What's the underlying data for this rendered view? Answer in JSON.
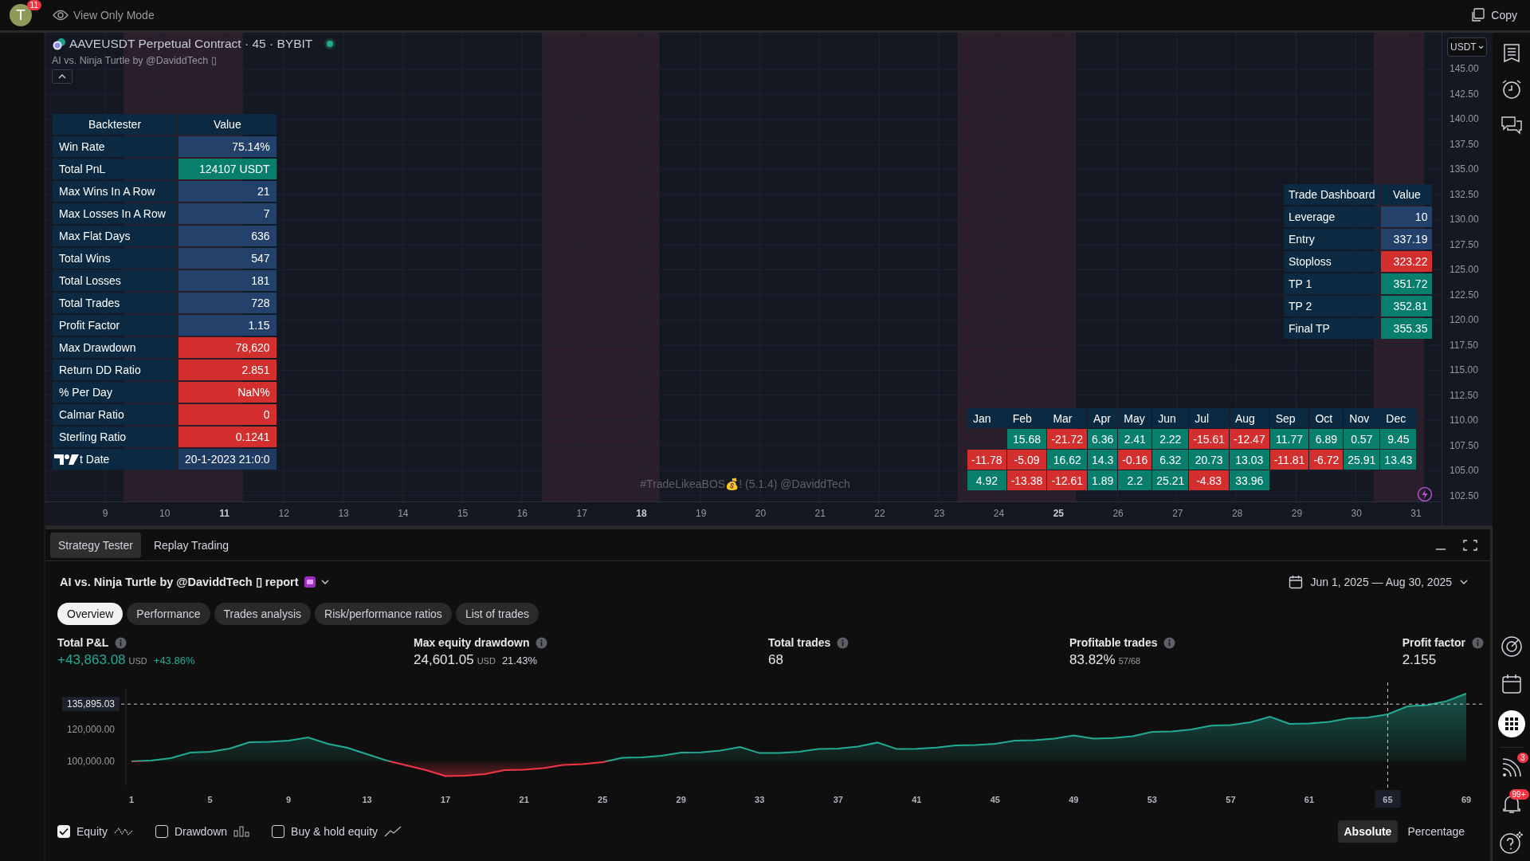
{
  "topbar": {
    "avatar_letter": "T",
    "avatar_badge": "11",
    "mode": "View Only Mode",
    "copy": "Copy"
  },
  "chart": {
    "symbol": "AAVEUSDT Perpetual Contract · 45 · BYBIT",
    "market_open": true,
    "indicator": "AI vs. Ninja Turtle by @DaviddTech ▯",
    "currency": "USDT",
    "watermark": "#TradeLikeaBOS💰! (5.1.4) @DaviddTech",
    "price_axis": [
      "145.00",
      "142.50",
      "140.00",
      "137.50",
      "135.00",
      "132.50",
      "130.00",
      "127.50",
      "125.00",
      "122.50",
      "120.00",
      "117.50",
      "115.00",
      "112.50",
      "110.00",
      "107.50",
      "105.00",
      "102.50"
    ],
    "time_axis": [
      {
        "label": "9",
        "emphasized": false
      },
      {
        "label": "10",
        "emphasized": false
      },
      {
        "label": "11",
        "emphasized": true
      },
      {
        "label": "12",
        "emphasized": false
      },
      {
        "label": "13",
        "emphasized": false
      },
      {
        "label": "14",
        "emphasized": false
      },
      {
        "label": "15",
        "emphasized": false
      },
      {
        "label": "16",
        "emphasized": false
      },
      {
        "label": "17",
        "emphasized": false
      },
      {
        "label": "18",
        "emphasized": true
      },
      {
        "label": "19",
        "emphasized": false
      },
      {
        "label": "20",
        "emphasized": false
      },
      {
        "label": "21",
        "emphasized": false
      },
      {
        "label": "22",
        "emphasized": false
      },
      {
        "label": "23",
        "emphasized": false
      },
      {
        "label": "24",
        "emphasized": false
      },
      {
        "label": "25",
        "emphasized": true
      },
      {
        "label": "26",
        "emphasized": false
      },
      {
        "label": "27",
        "emphasized": false
      },
      {
        "label": "28",
        "emphasized": false
      },
      {
        "label": "29",
        "emphasized": false
      },
      {
        "label": "30",
        "emphasized": false
      },
      {
        "label": "31",
        "emphasized": false
      }
    ],
    "backtester": {
      "columns": [
        "Backtester",
        "Value"
      ],
      "rows": [
        {
          "label": "Win Rate",
          "value": "75.14%",
          "color": "#24416b"
        },
        {
          "label": "Total PnL",
          "value": "124107 USDT",
          "color": "#087f6d"
        },
        {
          "label": "Max Wins In A Row",
          "value": "21",
          "color": "#24416b"
        },
        {
          "label": "Max Losses In A Row",
          "value": "7",
          "color": "#24416b"
        },
        {
          "label": "Max Flat Days",
          "value": "636",
          "color": "#24416b"
        },
        {
          "label": "Total Wins",
          "value": "547",
          "color": "#24416b"
        },
        {
          "label": "Total Losses",
          "value": "181",
          "color": "#24416b"
        },
        {
          "label": "Total Trades",
          "value": "728",
          "color": "#24416b"
        },
        {
          "label": "Profit Factor",
          "value": "1.15",
          "color": "#24416b"
        },
        {
          "label": "Max Drawdown",
          "value": "78,620",
          "color": "#d32f2f"
        },
        {
          "label": "Return DD Ratio",
          "value": "2.851",
          "color": "#d32f2f"
        },
        {
          "label": "% Per Day",
          "value": "NaN%",
          "color": "#d32f2f"
        },
        {
          "label": "Calmar Ratio",
          "value": "0",
          "color": "#d32f2f"
        },
        {
          "label": "Sterling Ratio",
          "value": "0.1241",
          "color": "#d32f2f"
        },
        {
          "label": "t Date",
          "value": "20-1-2023 21:0:0",
          "color": "#1f3b62",
          "covered_by_logo": true
        }
      ]
    },
    "trade_dashboard": {
      "columns": [
        "Trade Dashboard",
        "Value"
      ],
      "rows": [
        {
          "label": "Leverage",
          "value": "10",
          "color": "#24416b"
        },
        {
          "label": "Entry",
          "value": "337.19",
          "color": "#24416b"
        },
        {
          "label": "Stoploss",
          "value": "323.22",
          "color": "#d32f2f"
        },
        {
          "label": "TP 1",
          "value": "351.72",
          "color": "#087f6d"
        },
        {
          "label": "TP 2",
          "value": "352.81",
          "color": "#087f6d"
        },
        {
          "label": "Final TP",
          "value": "355.35",
          "color": "#087f6d"
        }
      ]
    },
    "monthly_returns": {
      "months": [
        "Jan",
        "Feb",
        "Mar",
        "Apr",
        "May",
        "Jun",
        "Jul",
        "Aug",
        "Sep",
        "Oct",
        "Nov",
        "Dec"
      ],
      "rows": [
        [
          null,
          {
            "value": "15.68",
            "color": "#087f6d"
          },
          {
            "value": "-21.72",
            "color": "#d32f2f"
          },
          {
            "value": "6.36",
            "color": "#087f6d"
          },
          {
            "value": "2.41",
            "color": "#087f6d"
          },
          {
            "value": "2.22",
            "color": "#087f6d"
          },
          {
            "value": "-15.61",
            "color": "#d32f2f"
          },
          {
            "value": "-12.47",
            "color": "#d32f2f"
          },
          {
            "value": "11.77",
            "color": "#087f6d"
          },
          {
            "value": "6.89",
            "color": "#087f6d"
          },
          {
            "value": "0.57",
            "color": "#087f6d"
          },
          {
            "value": "9.45",
            "color": "#087f6d"
          }
        ],
        [
          {
            "value": "-11.78",
            "color": "#d32f2f"
          },
          {
            "value": "-5.09",
            "color": "#d32f2f"
          },
          {
            "value": "16.62",
            "color": "#087f6d"
          },
          {
            "value": "14.3",
            "color": "#087f6d"
          },
          {
            "value": "-0.16",
            "color": "#d32f2f"
          },
          {
            "value": "6.32",
            "color": "#087f6d"
          },
          {
            "value": "20.73",
            "color": "#087f6d"
          },
          {
            "value": "13.03",
            "color": "#087f6d"
          },
          {
            "value": "-11.81",
            "color": "#d32f2f"
          },
          {
            "value": "-6.72",
            "color": "#d32f2f"
          },
          {
            "value": "25.91",
            "color": "#087f6d"
          },
          {
            "value": "13.43",
            "color": "#087f6d"
          }
        ],
        [
          {
            "value": "4.92",
            "color": "#087f6d"
          },
          {
            "value": "-13.38",
            "color": "#d32f2f"
          },
          {
            "value": "-12.61",
            "color": "#d32f2f"
          },
          {
            "value": "1.89",
            "color": "#087f6d"
          },
          {
            "value": "2.2",
            "color": "#087f6d"
          },
          {
            "value": "25.21",
            "color": "#087f6d"
          },
          {
            "value": "-4.83",
            "color": "#d32f2f"
          },
          {
            "value": "33.96",
            "color": "#087f6d"
          },
          null,
          null,
          null,
          null
        ]
      ]
    }
  },
  "strategy_panel": {
    "tabs": [
      {
        "label": "Strategy Tester",
        "selected": true
      },
      {
        "label": "Replay Trading",
        "selected": false
      }
    ],
    "report_title": "AI vs. Ninja Turtle by @DaviddTech ▯ report",
    "date_range": "Jun 1, 2025 — Aug 30, 2025",
    "sections": [
      {
        "label": "Overview",
        "selected": true
      },
      {
        "label": "Performance",
        "selected": false
      },
      {
        "label": "Trades analysis",
        "selected": false
      },
      {
        "label": "Risk/performance ratios",
        "selected": false
      },
      {
        "label": "List of trades",
        "selected": false
      }
    ],
    "metrics": [
      {
        "label": "Total P&L",
        "value": "+43,863.08",
        "unit": "USD",
        "extra": "+43.86%",
        "positive": true
      },
      {
        "label": "Max equity drawdown",
        "value": "24,601.05",
        "unit": "USD",
        "extra": "21.43%",
        "positive": false
      },
      {
        "label": "Total trades",
        "value": "68",
        "positive": false
      },
      {
        "label": "Profitable trades",
        "value": "83.82%",
        "extra": "57/68",
        "positive": false
      },
      {
        "label": "Profit factor",
        "value": "2.155",
        "positive": false
      }
    ],
    "chart_data": {
      "type": "area",
      "x": [
        1,
        2,
        3,
        4,
        5,
        6,
        7,
        8,
        9,
        10,
        11,
        12,
        13,
        14,
        15,
        16,
        17,
        18,
        19,
        20,
        21,
        22,
        23,
        24,
        25,
        26,
        27,
        28,
        29,
        30,
        31,
        32,
        33,
        34,
        35,
        36,
        37,
        38,
        39,
        40,
        41,
        42,
        43,
        44,
        45,
        46,
        47,
        48,
        49,
        50,
        51,
        52,
        53,
        54,
        55,
        56,
        57,
        58,
        59,
        60,
        61,
        62,
        63,
        64,
        65,
        66,
        67,
        68,
        69
      ],
      "xlim": [
        1,
        69
      ],
      "ylim": [
        85000,
        145000
      ],
      "series": [
        {
          "name": "Equity",
          "color": "#22ab94",
          "values": [
            100000,
            100500,
            102000,
            105500,
            106000,
            108000,
            112000,
            112200,
            113000,
            115000,
            111000,
            108500,
            104500,
            100500,
            97500,
            94500,
            90800,
            91000,
            92000,
            94500,
            94700,
            95800,
            97800,
            98200,
            99500,
            102300,
            102500,
            103500,
            105500,
            105600,
            106800,
            109000,
            105200,
            105300,
            106000,
            107800,
            108000,
            109200,
            111800,
            107700,
            107900,
            108600,
            110000,
            110200,
            111000,
            113000,
            113200,
            114200,
            116200,
            114300,
            114600,
            115800,
            118500,
            118800,
            120000,
            122400,
            122800,
            124500,
            128000,
            123500,
            123800,
            124800,
            127000,
            127500,
            129500,
            134500,
            135300,
            137800,
            142500
          ]
        }
      ],
      "xticks": [
        1,
        5,
        9,
        13,
        17,
        21,
        25,
        29,
        33,
        37,
        41,
        45,
        49,
        53,
        57,
        61,
        65,
        69
      ],
      "yticks": [
        {
          "value": 100000,
          "label": "100,000.00"
        },
        {
          "value": 120000,
          "label": "120,000.00"
        }
      ],
      "ref_lines": [
        {
          "axis": "y",
          "value": 135895.03,
          "label": "135,895.03"
        },
        {
          "axis": "x",
          "value": 65
        }
      ]
    },
    "legend": [
      {
        "checked": true,
        "kind": "equity"
      },
      {
        "label": "Drawdown",
        "checked": false,
        "kind": "drawdown"
      },
      {
        "label": "Buy & hold equity",
        "checked": false,
        "kind": "buyhold"
      }
    ],
    "scale_modes": [
      {
        "label": "Absolute",
        "selected": true
      },
      {
        "label": "Percentage",
        "selected": false
      }
    ]
  },
  "right_toolbar": {
    "feed_badge": "3",
    "alerts_badge": "99+"
  }
}
